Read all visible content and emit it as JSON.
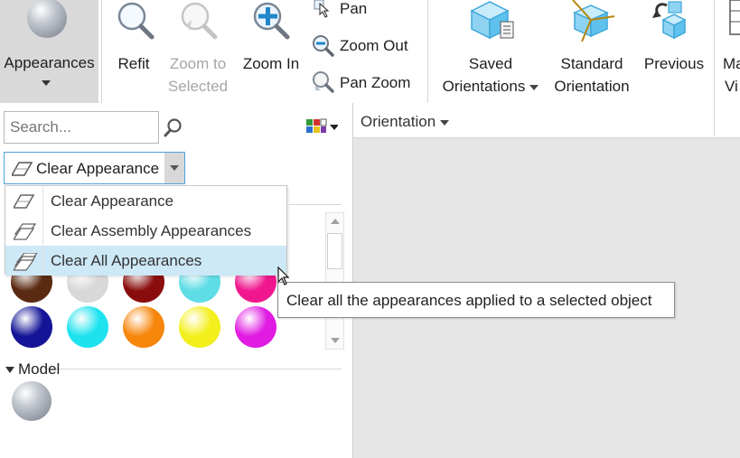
{
  "ribbon": {
    "appearances_label": "Appearances",
    "refit_label": "Refit",
    "zoom_selected_line1": "Zoom to",
    "zoom_selected_line2": "Selected",
    "zoom_in_label": "Zoom In",
    "pan_label": "Pan",
    "zoom_out_label": "Zoom Out",
    "pan_zoom_label": "Pan Zoom",
    "saved_orient_line1": "Saved",
    "saved_orient_line2": "Orientations",
    "standard_orient_line1": "Standard",
    "standard_orient_line2": "Orientation",
    "previous_label": "Previous",
    "cut_line1": "Ma",
    "cut_line2": "Vi",
    "orientation_group": "Orientation"
  },
  "panel": {
    "search_placeholder": "Search...",
    "combo_value": "Clear Appearance",
    "model_section": "Model"
  },
  "dropdown": {
    "items": [
      {
        "label": "Clear Appearance"
      },
      {
        "label": "Clear Assembly Appearances"
      },
      {
        "label": "Clear All Appearances"
      }
    ]
  },
  "tooltip": {
    "text": "Clear all the appearances applied to a selected object"
  },
  "colors": {
    "swatch_row1": [
      "#5a2a12",
      "#d8d8d8",
      "#8a0d0d",
      "#5fdde6",
      "#f0178e"
    ],
    "swatch_row2": [
      "#141497",
      "#1ee3ef",
      "#f7860c",
      "#f3ef1c",
      "#e01be2"
    ],
    "highlight": "#cde8f6",
    "accent": "#4da3d8"
  }
}
